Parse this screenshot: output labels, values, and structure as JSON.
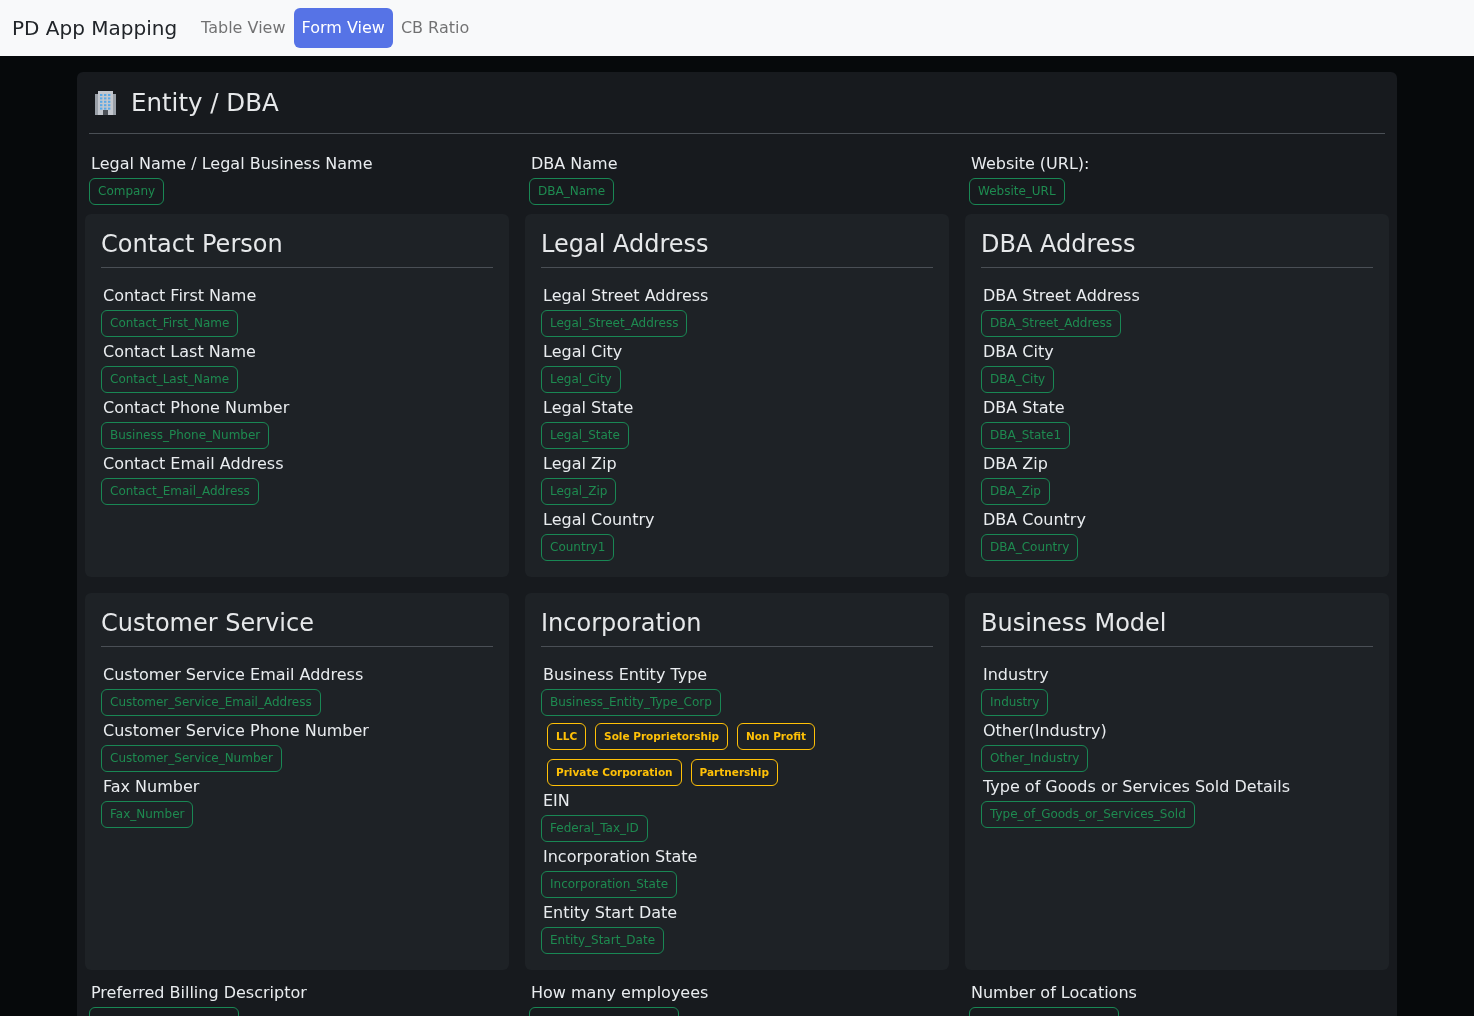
{
  "navbar": {
    "brand": "PD App Mapping",
    "tabs": [
      {
        "label": "Table View",
        "selected": false
      },
      {
        "label": "Form View",
        "selected": true
      },
      {
        "label": "CB Ratio",
        "selected": false
      }
    ]
  },
  "section": {
    "title": "Entity / DBA",
    "top_fields": [
      {
        "label": "Legal Name / Legal Business Name",
        "value": "Company"
      },
      {
        "label": "DBA Name",
        "value": "DBA_Name"
      },
      {
        "label": "Website (URL):",
        "value": "Website_URL"
      }
    ],
    "groups": [
      {
        "title": "Contact Person",
        "fields": [
          {
            "label": "Contact First Name",
            "value": "Contact_First_Name"
          },
          {
            "label": "Contact Last Name",
            "value": "Contact_Last_Name"
          },
          {
            "label": "Contact Phone Number",
            "value": "Business_Phone_Number"
          },
          {
            "label": "Contact Email Address",
            "value": "Contact_Email_Address"
          }
        ]
      },
      {
        "title": "Legal Address",
        "fields": [
          {
            "label": "Legal Street Address",
            "value": "Legal_Street_Address"
          },
          {
            "label": "Legal City",
            "value": "Legal_City"
          },
          {
            "label": "Legal State",
            "value": "Legal_State"
          },
          {
            "label": "Legal Zip",
            "value": "Legal_Zip"
          },
          {
            "label": "Legal Country",
            "value": "Country1"
          }
        ]
      },
      {
        "title": "DBA Address",
        "fields": [
          {
            "label": "DBA Street Address",
            "value": "DBA_Street_Address"
          },
          {
            "label": "DBA City",
            "value": "DBA_City"
          },
          {
            "label": "DBA State",
            "value": "DBA_State1"
          },
          {
            "label": "DBA Zip",
            "value": "DBA_Zip"
          },
          {
            "label": "DBA Country",
            "value": "DBA_Country"
          }
        ]
      },
      {
        "title": "Customer Service",
        "fields": [
          {
            "label": "Customer Service Email Address",
            "value": "Customer_Service_Email_Address"
          },
          {
            "label": "Customer Service Phone Number",
            "value": "Customer_Service_Number"
          },
          {
            "label": "Fax Number",
            "value": "Fax_Number"
          }
        ]
      },
      {
        "title": "Incorporation",
        "fields": [
          {
            "label": "Business Entity Type",
            "value": "Business_Entity_Type_Corp",
            "options": [
              "LLC",
              "Sole Proprietorship",
              "Non Profit",
              "Private Corporation",
              "Partnership"
            ]
          },
          {
            "label": "EIN",
            "value": "Federal_Tax_ID"
          },
          {
            "label": "Incorporation State",
            "value": "Incorporation_State"
          },
          {
            "label": "Entity Start Date",
            "value": "Entity_Start_Date"
          }
        ]
      },
      {
        "title": "Business Model",
        "fields": [
          {
            "label": "Industry",
            "value": "Industry"
          },
          {
            "label": "Other(Industry)",
            "value": "Other_Industry"
          },
          {
            "label": "Type of Goods or Services Sold Details",
            "value": "Type_of_Goods_or_Services_Sold"
          }
        ]
      }
    ],
    "bottom_fields": [
      {
        "label": "Preferred Billing Descriptor"
      },
      {
        "label": "How many employees"
      },
      {
        "label": "Number of Locations"
      }
    ]
  }
}
